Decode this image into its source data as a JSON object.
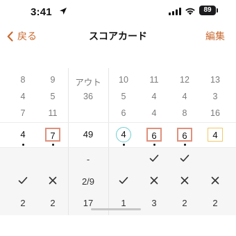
{
  "status_bar": {
    "time": "3:41",
    "battery": "89"
  },
  "nav": {
    "back_label": "戻る",
    "title": "スコアカード",
    "edit_label": "編集"
  },
  "columns": [
    {
      "id": "c8",
      "row0": "8",
      "row1": "4",
      "row2": "7",
      "score": "4",
      "score_style": "plain",
      "dot": true,
      "mark_a": "",
      "mark_b": "check",
      "putts": "2"
    },
    {
      "id": "c9",
      "row0": "9",
      "row1": "5",
      "row2": "11",
      "score": "7",
      "score_style": "red",
      "dot": true,
      "mark_a": "",
      "mark_b": "x",
      "putts": "2"
    },
    {
      "id": "out",
      "row0": "アウト",
      "row1": "36",
      "row2": "",
      "score": "49",
      "score_style": "plain",
      "dot": false,
      "mark_a": "-",
      "mark_b": "2/9",
      "putts": "17"
    },
    {
      "id": "c10",
      "row0": "10",
      "row1": "5",
      "row2": "6",
      "score": "4",
      "score_style": "circle",
      "dot": true,
      "mark_a": "",
      "mark_b": "check",
      "putts": "1"
    },
    {
      "id": "c11",
      "row0": "11",
      "row1": "4",
      "row2": "4",
      "score": "6",
      "score_style": "red",
      "dot": true,
      "mark_a": "check",
      "mark_b": "x",
      "putts": "3"
    },
    {
      "id": "c12",
      "row0": "12",
      "row1": "4",
      "row2": "8",
      "score": "6",
      "score_style": "red",
      "dot": true,
      "mark_a": "check",
      "mark_b": "x",
      "putts": "2"
    },
    {
      "id": "c13",
      "row0": "13",
      "row1": "3",
      "row2": "16",
      "score": "4",
      "score_style": "yellow",
      "dot": false,
      "mark_a": "",
      "mark_b": "x",
      "putts": "2"
    }
  ]
}
